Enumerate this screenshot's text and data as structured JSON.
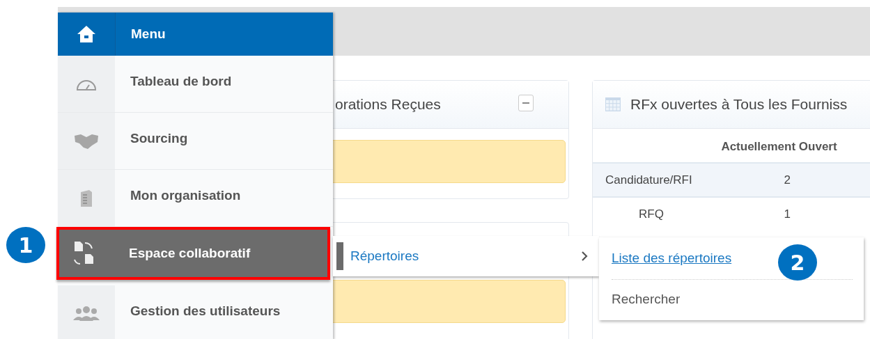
{
  "menu": {
    "title": "Menu",
    "items": [
      {
        "label": "Tableau de bord",
        "selected": false
      },
      {
        "label": "Sourcing",
        "selected": false
      },
      {
        "label": "Mon organisation",
        "selected": false
      },
      {
        "label": "Espace collaboratif",
        "selected": true
      },
      {
        "label": "Gestion des utilisateurs",
        "selected": false
      }
    ]
  },
  "submenu": {
    "items": [
      {
        "label": "Répertoires",
        "selected": true
      }
    ]
  },
  "flyout": {
    "items": [
      {
        "label": "Liste des répertoires",
        "kind": "link"
      },
      {
        "label": "Rechercher",
        "kind": "plain"
      }
    ]
  },
  "callouts": [
    "1",
    "2"
  ],
  "collaborations_card": {
    "title": "orations Reçues"
  },
  "rfx_card": {
    "title": "RFx ouvertes à Tous les Fourniss",
    "columns": [
      "Actuellement Ouvert"
    ],
    "rows": [
      {
        "label": "Candidature/RFI",
        "value": "2"
      },
      {
        "label": "RFQ",
        "value": "1"
      }
    ]
  }
}
